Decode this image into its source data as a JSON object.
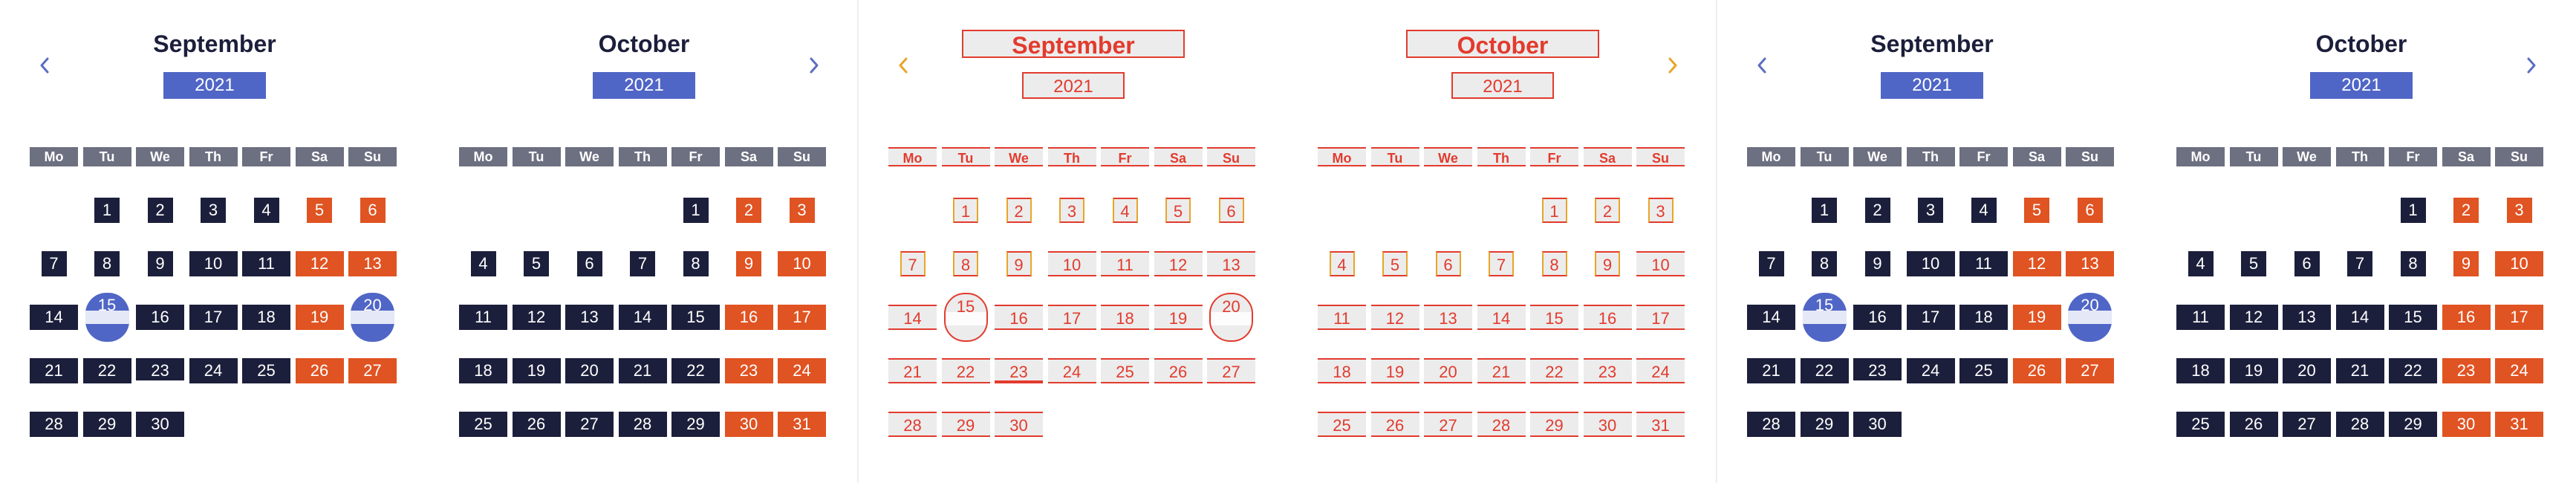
{
  "colors": {
    "dark": "#1c1f3b",
    "weekend": "#e05322",
    "accent": "#5066c6",
    "weekday_header": "#6c7080",
    "nav_blue": "#5a6fc0",
    "nav_yellow": "#e8a52a",
    "outline_red": "#e23b2e",
    "outline_fill": "#ececec"
  },
  "icons": {
    "prev": "chevron-left-icon",
    "next": "chevron-right-icon"
  },
  "weekdays": [
    "Mo",
    "Tu",
    "We",
    "Th",
    "Fr",
    "Sa",
    "Su"
  ],
  "calendars": [
    {
      "month": "September",
      "year": "2021",
      "offset": 1,
      "days_in_month": 30,
      "selected_days": [
        15,
        20
      ],
      "today": 23,
      "has_prev": true,
      "has_next": false
    },
    {
      "month": "October",
      "year": "2021",
      "offset": 4,
      "days_in_month": 31,
      "selected_days": [],
      "today": null,
      "has_prev": false,
      "has_next": true
    }
  ],
  "pairs": [
    {
      "style": "filled",
      "nav": "blue",
      "calendars": [
        0,
        1
      ]
    },
    {
      "style": "outline",
      "nav": "yellow",
      "calendars": [
        0,
        1
      ]
    },
    {
      "style": "filled",
      "nav": "blue",
      "calendars": [
        0,
        1
      ]
    }
  ]
}
